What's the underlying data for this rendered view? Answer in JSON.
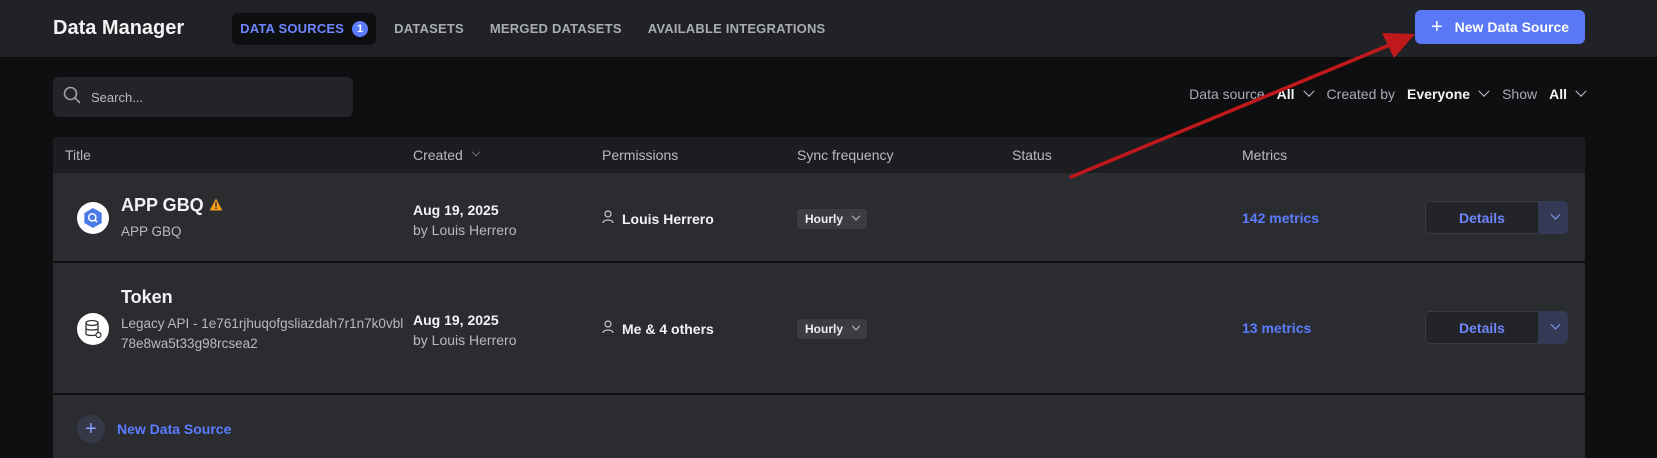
{
  "app": {
    "title": "Data Manager"
  },
  "nav": {
    "tabs": [
      {
        "label": "DATA SOURCES",
        "badge": "1",
        "active": true
      },
      {
        "label": "DATASETS"
      },
      {
        "label": "MERGED DATASETS"
      },
      {
        "label": "AVAILABLE INTEGRATIONS"
      }
    ]
  },
  "header": {
    "new_button_label": "New Data Source",
    "new_button_icon": "plus-icon"
  },
  "search": {
    "placeholder": "Search...",
    "value": ""
  },
  "filters": {
    "data_source": {
      "label": "Data source",
      "value": "All"
    },
    "created_by": {
      "label": "Created by",
      "value": "Everyone"
    },
    "show": {
      "label": "Show",
      "value": "All"
    }
  },
  "table": {
    "columns": [
      "Title",
      "Created",
      "Permissions",
      "Sync frequency",
      "Status",
      "Metrics"
    ],
    "rows": [
      {
        "name": "APP GBQ",
        "subtitle": "APP GBQ",
        "icon": "bigquery-icon",
        "warning": true,
        "created_date": "Aug 19, 2025",
        "created_by": "by Louis Herrero",
        "permissions": "Louis Herrero",
        "sync": "Hourly",
        "status": "",
        "metrics": "142 metrics",
        "action": "Details"
      },
      {
        "name": "Token",
        "subtitle": "Legacy API - 1e761rjhuqofgsliazdah7r1n7k0vbl78e8wa5t33g98rcsea2",
        "icon": "database-icon",
        "warning": false,
        "created_date": "Aug 19, 2025",
        "created_by": "by Louis Herrero",
        "permissions": "Me & 4 others",
        "sync": "Hourly",
        "status": "",
        "metrics": "13 metrics",
        "action": "Details"
      }
    ],
    "add_row_label": "New Data Source"
  },
  "colors": {
    "accent": "#5a77f5",
    "link": "#5b7cff",
    "warning": "#f29a1f",
    "annotation_arrow": "#c0191c"
  }
}
